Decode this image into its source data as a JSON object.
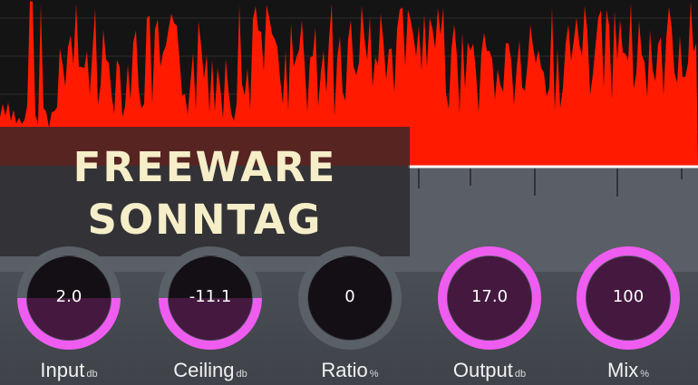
{
  "banner": {
    "line1": "FREEWARE",
    "line2": "SONNTAG"
  },
  "colors": {
    "waveform": "#ff1a00",
    "ring_active": "#ef5cf0",
    "ring_inactive": "#596068",
    "knob_fill": "#140f14",
    "knob_fill_active": "#45193f",
    "banner_text": "#f6eec8"
  },
  "knobs": [
    {
      "name": "Input",
      "value": "2.0",
      "unit": "db",
      "level": 0.5,
      "ring": "partial"
    },
    {
      "name": "Ceiling",
      "value": "-11.1",
      "unit": "db",
      "level": 0.5,
      "ring": "partial"
    },
    {
      "name": "Ratio",
      "value": "0",
      "unit": "%",
      "level": 0.0,
      "ring": "none"
    },
    {
      "name": "Output",
      "value": "17.0",
      "unit": "db",
      "level": 1.0,
      "ring": "full"
    },
    {
      "name": "Mix",
      "value": "100",
      "unit": "%",
      "level": 1.0,
      "ring": "full"
    }
  ]
}
